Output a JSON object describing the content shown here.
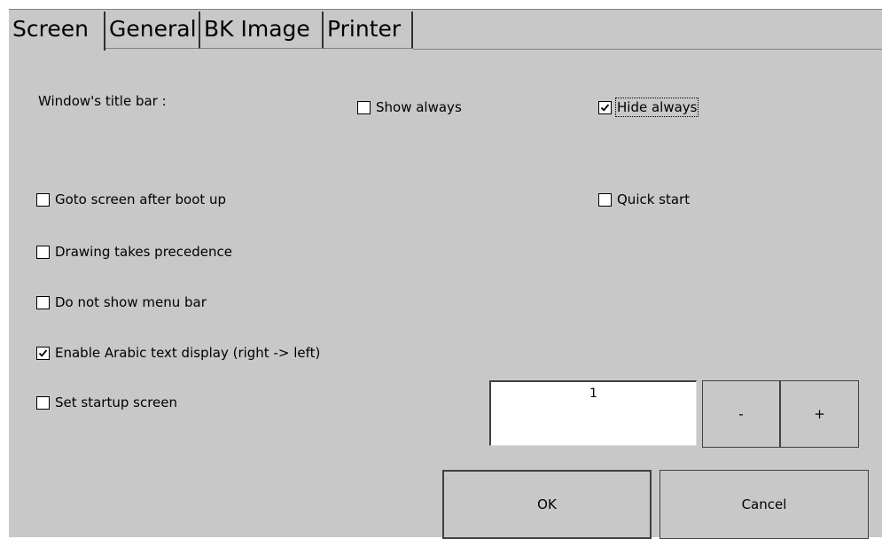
{
  "tabs": [
    {
      "label": "Screen",
      "active": true
    },
    {
      "label": "General",
      "active": false
    },
    {
      "label": "BK Image",
      "active": false
    },
    {
      "label": "Printer",
      "active": false
    }
  ],
  "title_bar": {
    "label": "Window's title bar :",
    "show_always": {
      "label": "Show always",
      "checked": false
    },
    "hide_always": {
      "label": "Hide always",
      "checked": true
    }
  },
  "options": {
    "goto_screen": {
      "label": "Goto screen after boot up",
      "checked": false
    },
    "quick_start": {
      "label": "Quick start",
      "checked": false
    },
    "drawing_precedence": {
      "label": "Drawing takes precedence",
      "checked": false
    },
    "no_menu_bar": {
      "label": "Do not show menu bar",
      "checked": false
    },
    "arabic": {
      "label": "Enable Arabic text display (right -> left)",
      "checked": true
    },
    "startup_screen": {
      "label": "Set startup screen",
      "checked": false
    }
  },
  "startup": {
    "value": "1",
    "minus_label": "-",
    "plus_label": "+"
  },
  "buttons": {
    "ok_label": "OK",
    "cancel_label": "Cancel"
  }
}
